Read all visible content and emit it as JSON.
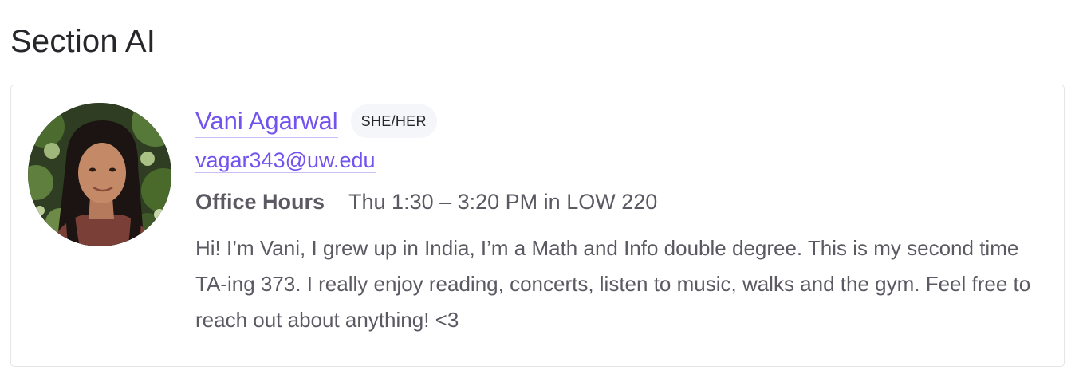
{
  "section": {
    "title": "Section AI"
  },
  "staff": {
    "name": "Vani Agarwal",
    "pronouns": "SHE/HER",
    "email": "vagar343@uw.edu",
    "office_hours_label": "Office Hours",
    "office_hours": "Thu 1:30 – 3:20 PM in LOW 220",
    "bio": "Hi! I’m Vani, I grew up in India, I’m a Math and Info double degree. This is my second time TA-ing 373. I really enjoy reading, concerts, listen to music, walks and the gym. Feel free to reach out about anything! <3",
    "avatar_icon": "profile-photo"
  },
  "colors": {
    "link": "#7253ed",
    "text": "#5c5962",
    "heading": "#27262b",
    "badge_bg": "#f5f6fa",
    "card_border": "#e4e4e9"
  }
}
